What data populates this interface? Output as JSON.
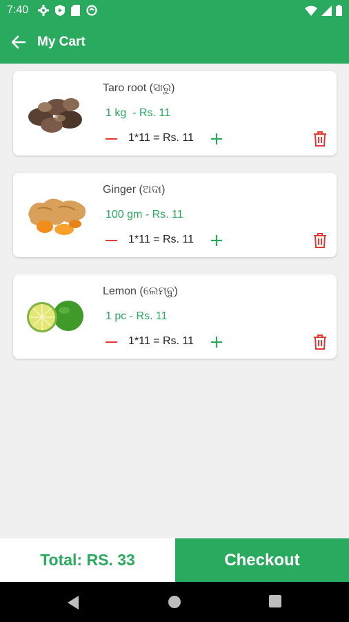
{
  "status_bar": {
    "time": "7:40"
  },
  "app_bar": {
    "title": "My Cart"
  },
  "cart": {
    "items": [
      {
        "name": "Taro root (ସାରୁ)",
        "price": "1 kg  - Rs. 11",
        "qty": "1*11 = Rs. 11",
        "image": "taro-root"
      },
      {
        "name": "Ginger (ଅଦା)",
        "price": "100 gm - Rs. 11",
        "qty": "1*11 = Rs. 11",
        "image": "ginger"
      },
      {
        "name": "Lemon (ଲେମ୍ବୁ)",
        "price": "1 pc - Rs. 11",
        "qty": "1*11 = Rs. 11",
        "image": "lemon"
      }
    ]
  },
  "footer": {
    "total": "Total: RS. 33",
    "checkout": "Checkout"
  },
  "colors": {
    "primary": "#2aaa5e",
    "minus": "#e53935",
    "delete": "#e53935"
  },
  "icons": [
    "back-arrow-icon",
    "minus-icon",
    "plus-icon",
    "trash-icon",
    "nav-back-icon",
    "nav-home-icon",
    "nav-recents-icon"
  ]
}
